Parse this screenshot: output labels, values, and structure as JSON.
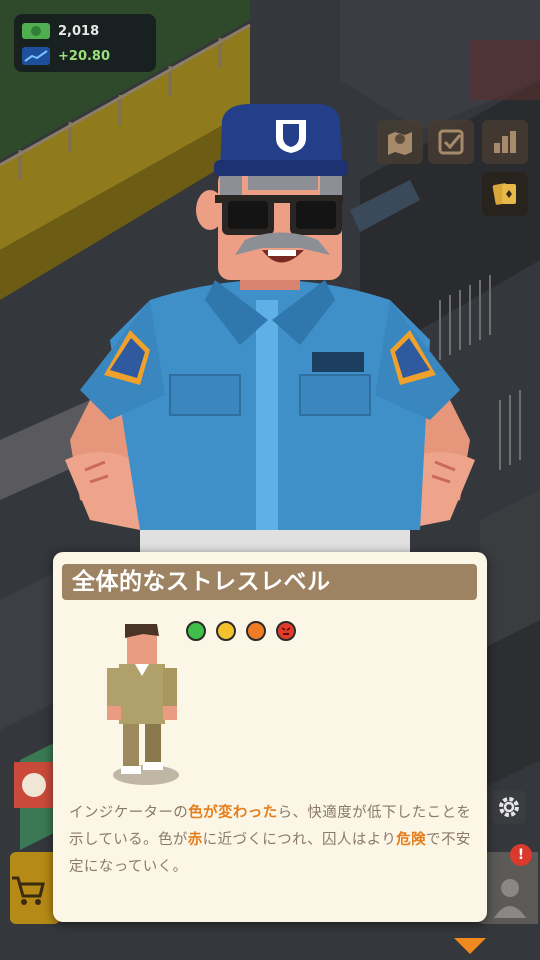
{
  "hud": {
    "money": "2,018",
    "income_rate": "+20.80",
    "money_icon": "cash-icon",
    "rate_icon": "trend-icon"
  },
  "side_buttons": [
    "map-icon",
    "checklist-icon",
    "stats-icon",
    "cards-icon"
  ],
  "card": {
    "title": "全体的なストレスレベル",
    "indicators": [
      {
        "level": "calm",
        "color": "#3fbf4a"
      },
      {
        "level": "mild",
        "color": "#f2c12e"
      },
      {
        "level": "stressed",
        "color": "#ef7b25"
      },
      {
        "level": "angry",
        "color": "#e23b2a"
      }
    ],
    "description": {
      "p1": "インジケーターの",
      "h1": "色が変わった",
      "p2": "ら、快適度が低下したことを示している。色が",
      "h2": "赤",
      "p3": "に近づくにつれ、囚人はより",
      "h3": "危険",
      "p4": "で不安定になっていく。"
    }
  },
  "alert_badge": "!",
  "colors": {
    "card_bg": "#fbf6e6",
    "title_bar": "#9e8362",
    "highlight": "#e67e1c",
    "text": "#8a7a6a"
  }
}
